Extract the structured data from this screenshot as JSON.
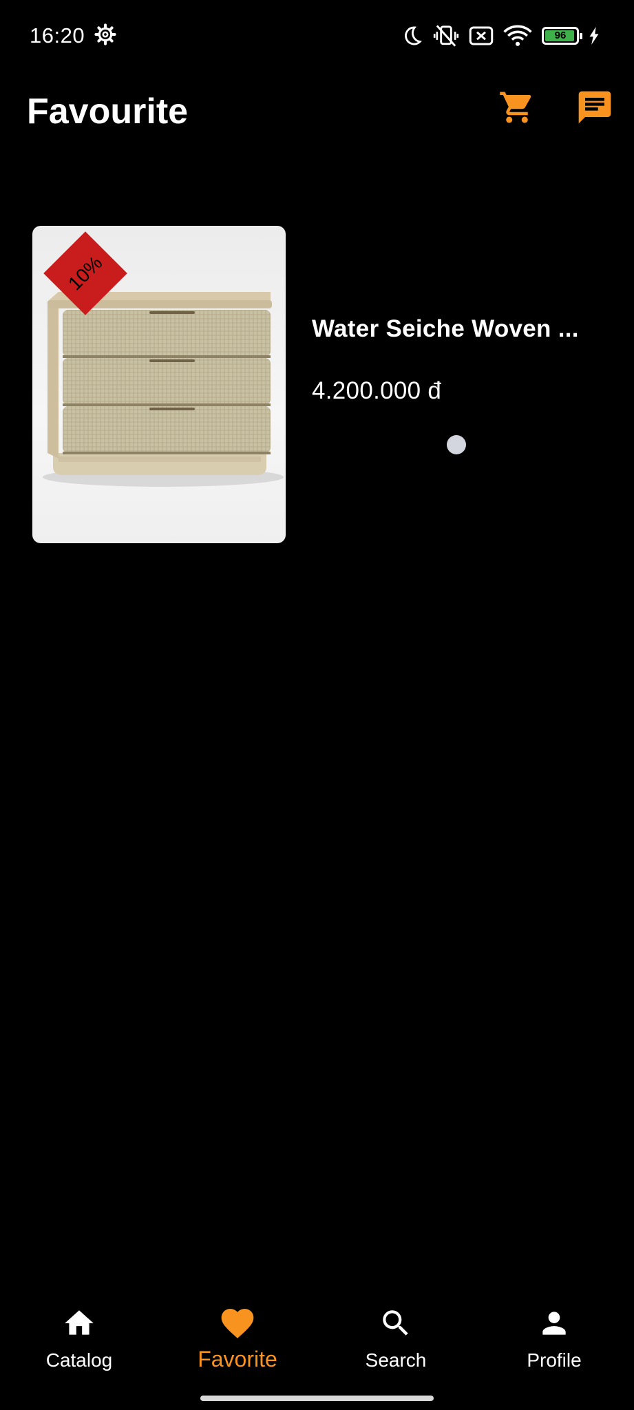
{
  "status_bar": {
    "time": "16:20",
    "battery_level": "96",
    "battery_percent": 96,
    "icons": [
      "settings-gear-icon",
      "moon-icon",
      "vibrate-off-icon",
      "sim-x-icon",
      "wifi-icon",
      "battery-icon",
      "charging-bolt-icon"
    ]
  },
  "header": {
    "title": "Favourite",
    "cart_icon": "shopping-cart-icon",
    "chat_icon": "chat-message-icon"
  },
  "favourites": [
    {
      "discount": "10%",
      "name": "Water Seiche Woven ...",
      "price": "4.200.000 đ",
      "image": "woven-dresser-photo"
    }
  ],
  "bottom_nav": {
    "items": [
      {
        "label": "Catalog",
        "icon": "home-icon",
        "active": false
      },
      {
        "label": "Favorite",
        "icon": "heart-icon",
        "active": true
      },
      {
        "label": "Search",
        "icon": "search-icon",
        "active": false
      },
      {
        "label": "Profile",
        "icon": "person-icon",
        "active": false
      }
    ]
  },
  "colors": {
    "accent": "#f7931e",
    "background": "#000000",
    "discount_badge": "#c91d1d",
    "battery_fill": "#3fb14a"
  }
}
